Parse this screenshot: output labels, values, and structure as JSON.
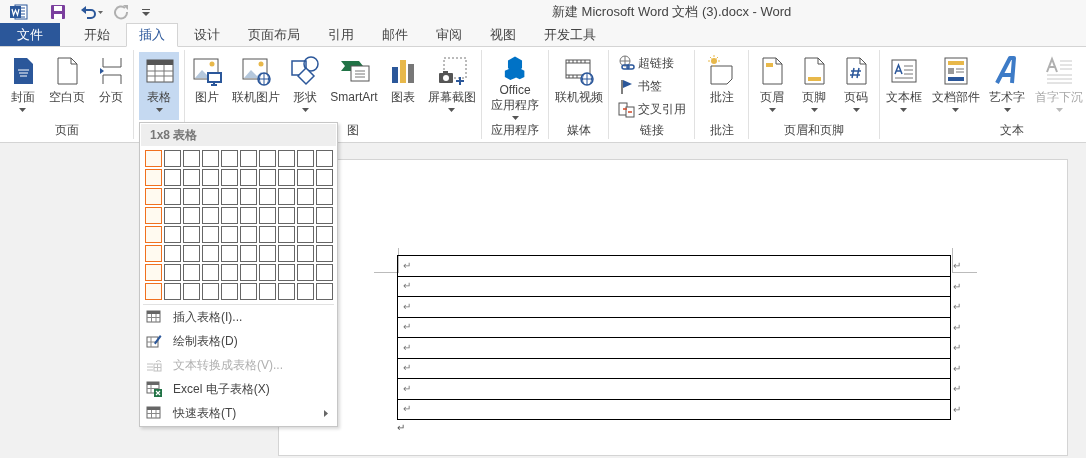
{
  "window": {
    "title": "新建 Microsoft Word 文档 (3).docx - Word",
    "quick_access": [
      {
        "kind": "save",
        "disabled": false
      },
      {
        "kind": "undo",
        "disabled": false
      },
      {
        "kind": "redo",
        "disabled": true
      },
      {
        "kind": "customize",
        "disabled": false
      }
    ]
  },
  "tabs": [
    {
      "label": "文件",
      "selected": false,
      "kind": "file"
    },
    {
      "label": "开始",
      "selected": false,
      "kind": "tab"
    },
    {
      "label": "插入",
      "selected": true,
      "kind": "tab"
    },
    {
      "label": "设计",
      "selected": false,
      "kind": "tab"
    },
    {
      "label": "页面布局",
      "selected": false,
      "kind": "tab"
    },
    {
      "label": "引用",
      "selected": false,
      "kind": "tab"
    },
    {
      "label": "邮件",
      "selected": false,
      "kind": "tab"
    },
    {
      "label": "审阅",
      "selected": false,
      "kind": "tab"
    },
    {
      "label": "视图",
      "selected": false,
      "kind": "tab"
    },
    {
      "label": "开发工具",
      "selected": false,
      "kind": "tab"
    }
  ],
  "ribbon_groups": [
    {
      "label": "页面",
      "items": [
        {
          "kind": "large",
          "label": "封面",
          "dropdown": true,
          "pressed": false,
          "disabled": false
        },
        {
          "kind": "large",
          "label": "空白页",
          "dropdown": false,
          "pressed": false,
          "disabled": false
        },
        {
          "kind": "large",
          "label": "分页",
          "dropdown": false,
          "pressed": false,
          "disabled": false
        }
      ]
    },
    {
      "items": [
        {
          "kind": "large",
          "label": "表格",
          "dropdown": true,
          "pressed": true,
          "disabled": false
        }
      ]
    },
    {
      "label": "图",
      "items": [
        {
          "kind": "large",
          "label": "图片",
          "dropdown": false,
          "pressed": false,
          "disabled": false
        },
        {
          "kind": "large",
          "label": "联机图片",
          "dropdown": false,
          "pressed": false,
          "disabled": false
        },
        {
          "kind": "large",
          "label": "形状",
          "dropdown": true,
          "pressed": false,
          "disabled": false
        },
        {
          "kind": "large",
          "label": "SmartArt",
          "dropdown": false,
          "pressed": false,
          "disabled": false
        },
        {
          "kind": "large",
          "label": "图表",
          "dropdown": false,
          "pressed": false,
          "disabled": false
        },
        {
          "kind": "large",
          "label": "屏幕截图",
          "dropdown": true,
          "pressed": false,
          "disabled": false
        }
      ]
    },
    {
      "label": "应用程序",
      "items": [
        {
          "kind": "large",
          "label": "Office",
          "label_2": "应用程序",
          "dropdown": true,
          "pressed": false,
          "disabled": false
        }
      ]
    },
    {
      "label": "媒体",
      "items": [
        {
          "kind": "large",
          "label": "联机视频",
          "dropdown": false,
          "pressed": false,
          "disabled": false
        }
      ]
    },
    {
      "label": "链接",
      "items": [
        {
          "kind": "small",
          "label": "超链接",
          "pressed": false,
          "disabled": false
        },
        {
          "kind": "small",
          "label": "书签",
          "pressed": false,
          "disabled": false
        },
        {
          "kind": "small",
          "label": "交叉引用",
          "pressed": false,
          "disabled": false
        }
      ]
    },
    {
      "label": "批注",
      "items": [
        {
          "kind": "large",
          "label": "批注",
          "dropdown": false,
          "pressed": false,
          "disabled": false
        }
      ]
    },
    {
      "label": "页眉和页脚",
      "items": [
        {
          "kind": "large",
          "label": "页眉",
          "dropdown": true,
          "pressed": false,
          "disabled": false
        },
        {
          "kind": "large",
          "label": "页脚",
          "dropdown": true,
          "pressed": false,
          "disabled": false
        },
        {
          "kind": "large",
          "label": "页码",
          "dropdown": true,
          "pressed": false,
          "disabled": false
        }
      ]
    },
    {
      "label": "文本",
      "items": [
        {
          "kind": "large",
          "label": "文本框",
          "dropdown": true,
          "pressed": false,
          "disabled": false
        },
        {
          "kind": "large",
          "label": "文档部件",
          "dropdown": true,
          "pressed": false,
          "disabled": false
        },
        {
          "kind": "large",
          "label": "艺术字",
          "dropdown": true,
          "pressed": false,
          "disabled": false
        },
        {
          "kind": "large",
          "label": "首字下沉",
          "dropdown": true,
          "pressed": false,
          "disabled": true
        }
      ]
    }
  ],
  "table_menu": {
    "header": "1x8 表格",
    "grid": [
      {
        "cells": [
          true,
          false,
          false,
          false,
          false,
          false,
          false,
          false,
          false,
          false
        ]
      },
      {
        "cells": [
          true,
          false,
          false,
          false,
          false,
          false,
          false,
          false,
          false,
          false
        ]
      },
      {
        "cells": [
          true,
          false,
          false,
          false,
          false,
          false,
          false,
          false,
          false,
          false
        ]
      },
      {
        "cells": [
          true,
          false,
          false,
          false,
          false,
          false,
          false,
          false,
          false,
          false
        ]
      },
      {
        "cells": [
          true,
          false,
          false,
          false,
          false,
          false,
          false,
          false,
          false,
          false
        ]
      },
      {
        "cells": [
          true,
          false,
          false,
          false,
          false,
          false,
          false,
          false,
          false,
          false
        ]
      },
      {
        "cells": [
          true,
          false,
          false,
          false,
          false,
          false,
          false,
          false,
          false,
          false
        ]
      },
      {
        "cells": [
          true,
          false,
          false,
          false,
          false,
          false,
          false,
          false,
          false,
          false
        ]
      }
    ],
    "items": [
      {
        "label": "插入表格(I)...",
        "disabled": false,
        "submenu": false
      },
      {
        "label": "绘制表格(D)",
        "disabled": false,
        "submenu": false
      },
      {
        "label": "文本转换成表格(V)...",
        "disabled": true,
        "submenu": false
      },
      {
        "label": "Excel 电子表格(X)",
        "disabled": false,
        "submenu": false
      },
      {
        "label": "快速表格(T)",
        "disabled": false,
        "submenu": true
      }
    ]
  },
  "document": {
    "table_rows": [
      {
        "cell_mark": "↵",
        "row_mark": "↵"
      },
      {
        "cell_mark": "↵",
        "row_mark": "↵"
      },
      {
        "cell_mark": "↵",
        "row_mark": "↵"
      },
      {
        "cell_mark": "↵",
        "row_mark": "↵"
      },
      {
        "cell_mark": "↵",
        "row_mark": "↵"
      },
      {
        "cell_mark": "↵",
        "row_mark": "↵"
      },
      {
        "cell_mark": "↵",
        "row_mark": "↵"
      },
      {
        "cell_mark": "↵",
        "row_mark": "↵"
      }
    ],
    "paragraph_mark": "↵"
  }
}
